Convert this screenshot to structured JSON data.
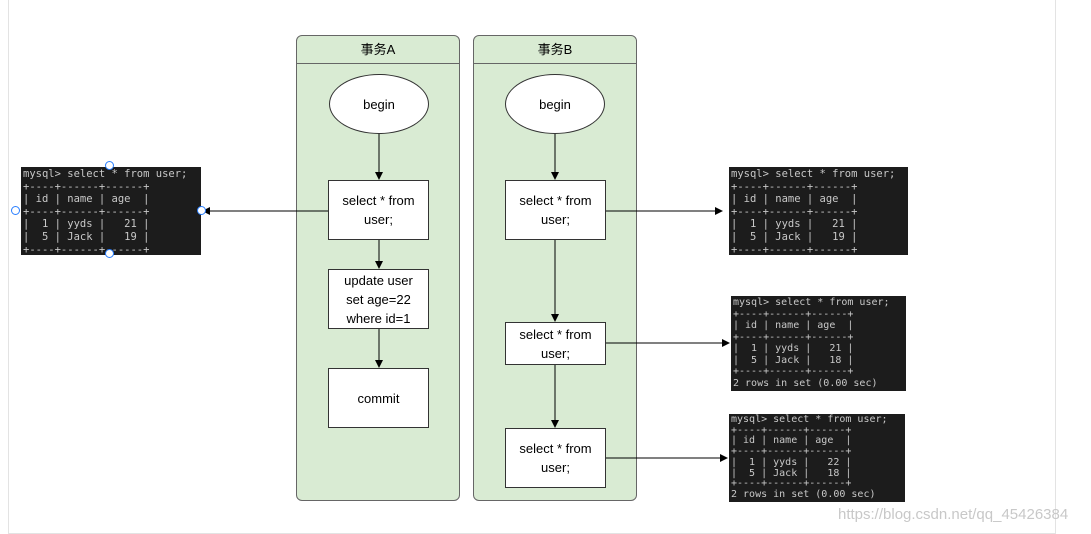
{
  "lanes": [
    {
      "title": "事务A",
      "start": "begin",
      "steps": [
        "select * from\nuser;",
        "update user\nset age=22\nwhere id=1",
        "commit"
      ]
    },
    {
      "title": "事务B",
      "start": "begin",
      "steps": [
        "select * from\nuser;",
        "select * from\nuser;",
        "select * from\nuser;"
      ]
    }
  ],
  "terminals": [
    {
      "text": "mysql> select * from user;\n+----+------+------+\n| id | name | age  |\n+----+------+------+\n|  1 | yyds |   21 |\n|  5 | Jack |   19 |\n+----+------+------+"
    },
    {
      "text": "mysql> select * from user;\n+----+------+------+\n| id | name | age  |\n+----+------+------+\n|  1 | yyds |   21 |\n|  5 | Jack |   19 |\n+----+------+------+"
    },
    {
      "text": "mysql> select * from user;\n+----+------+------+\n| id | name | age  |\n+----+------+------+\n|  1 | yyds |   21 |\n|  5 | Jack |   18 |\n+----+------+------+\n2 rows in set (0.00 sec)"
    },
    {
      "text": "mysql> select * from user;\n+----+------+------+\n| id | name | age  |\n+----+------+------+\n|  1 | yyds |   22 |\n|  5 | Jack |   18 |\n+----+------+------+\n2 rows in set (0.00 sec)"
    }
  ],
  "watermark": "https://blog.csdn.net/qq_45426384"
}
